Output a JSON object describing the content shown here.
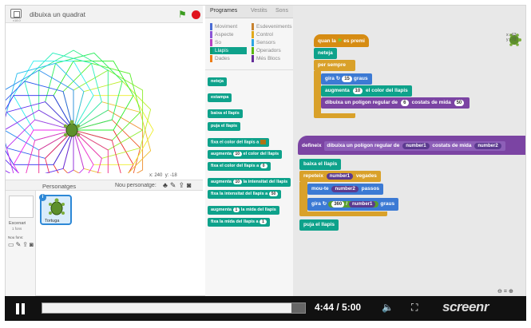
{
  "stage": {
    "version_label": "v18.0",
    "project_title": "dibuixa un quadrat",
    "coords_x_label": "x:",
    "coords_x": "240",
    "coords_y_label": "y:",
    "coords_y": "-18"
  },
  "sprites_pane": {
    "title": "Personatges",
    "new_sprite_label": "Nou personatge:",
    "stage_label": "Escenari",
    "stage_sub": "1 fons",
    "new_backdrop_label": "Nou fons:",
    "sprite_name": "Tortuga"
  },
  "palette": {
    "tabs": [
      "Programes",
      "Vestits",
      "Sons"
    ],
    "categories": [
      {
        "label": "Moviment",
        "color": "#4a6cd4"
      },
      {
        "label": "Esdeveniments",
        "color": "#c88330"
      },
      {
        "label": "Aspecte",
        "color": "#8a55d7"
      },
      {
        "label": "Control",
        "color": "#e1a91a"
      },
      {
        "label": "So",
        "color": "#bb42c3"
      },
      {
        "label": "Sensors",
        "color": "#2ca5e2"
      },
      {
        "label": "Llapis",
        "color": "#0e9a6c"
      },
      {
        "label": "Operadors",
        "color": "#5cb712"
      },
      {
        "label": "Dades",
        "color": "#ee7d16"
      },
      {
        "label": "Més Blocs",
        "color": "#632d99"
      }
    ],
    "blocks": {
      "b1": "neteja",
      "b2": "estampa",
      "b3": "baixa el llapis",
      "b4": "puja el llapis",
      "b5": "fixa el color del llapis a",
      "b6a": "augmenta",
      "b6v": "10",
      "b6b": "el color del llapis",
      "b7a": "fixa el color del llapis a",
      "b7v": "0",
      "b8a": "augmenta",
      "b8v": "10",
      "b8b": "la intensitat del llapis",
      "b9a": "fixa la intensitat del llapis a",
      "b9v": "50",
      "b10a": "augmenta",
      "b10v": "1",
      "b10b": "la mida del llapis",
      "b11a": "fixa la mida del llapis a",
      "b11v": "1"
    }
  },
  "scripts": {
    "s1": {
      "hat_a": "quan la",
      "hat_b": "es premi",
      "clear": "neteja",
      "forever": "per sempre",
      "turn_a": "gira",
      "turn_v": "15",
      "turn_b": "graus",
      "change_a": "augmenta",
      "change_v": "10",
      "change_b": "el color del llapis",
      "custom_a": "dibuixa un polígon regular de",
      "custom_v1": "6",
      "custom_b": "costats de mida",
      "custom_v2": "50"
    },
    "s2": {
      "define": "defineix",
      "name_a": "dibuixa un polígon regular de",
      "param1": "number1",
      "name_b": "costats de mida",
      "param2": "number2",
      "pen_down": "baixa el llapis",
      "repeat": "repeteix",
      "rep_param": "number1",
      "rep_b": "vegades",
      "move_a": "mou-te",
      "move_param": "number2",
      "move_b": "passos",
      "turn_a": "gira",
      "turn_v": "360",
      "turn_op": "/",
      "turn_param": "number1",
      "turn_b": "graus",
      "pen_up": "puja el llapis"
    },
    "sprite_x": "x: -63",
    "sprite_y": "y: -72"
  },
  "player": {
    "time": "4:44 / 5:00",
    "brand": "screenr",
    "progress": 0.947
  }
}
